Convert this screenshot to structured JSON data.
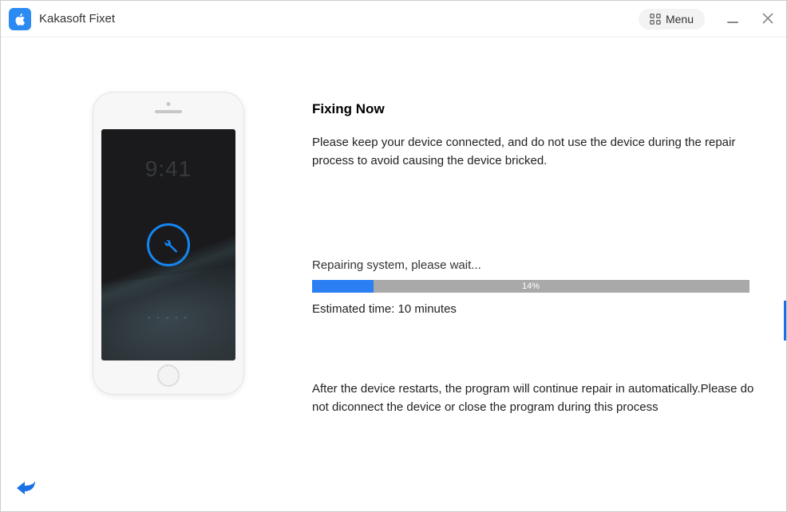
{
  "titlebar": {
    "app_name": "Kakasoft Fixet",
    "menu_label": "Menu"
  },
  "phone": {
    "screen_time": "9:41",
    "overlay_icon": "wrench-icon"
  },
  "main": {
    "heading": "Fixing Now",
    "intro": "Please keep your device connected, and do not use the device during the repair process to avoid causing the device bricked.",
    "status_label": "Repairing system, please wait...",
    "progress_percent": 14,
    "progress_label": "14%",
    "estimated_time": "Estimated time: 10 minutes",
    "footer_note": "After the device restarts, the program will continue repair in automatically.Please do not diconnect the device or close the program during this process"
  },
  "colors": {
    "accent": "#2b7ff2",
    "progress_bg": "#a9a9a9"
  }
}
